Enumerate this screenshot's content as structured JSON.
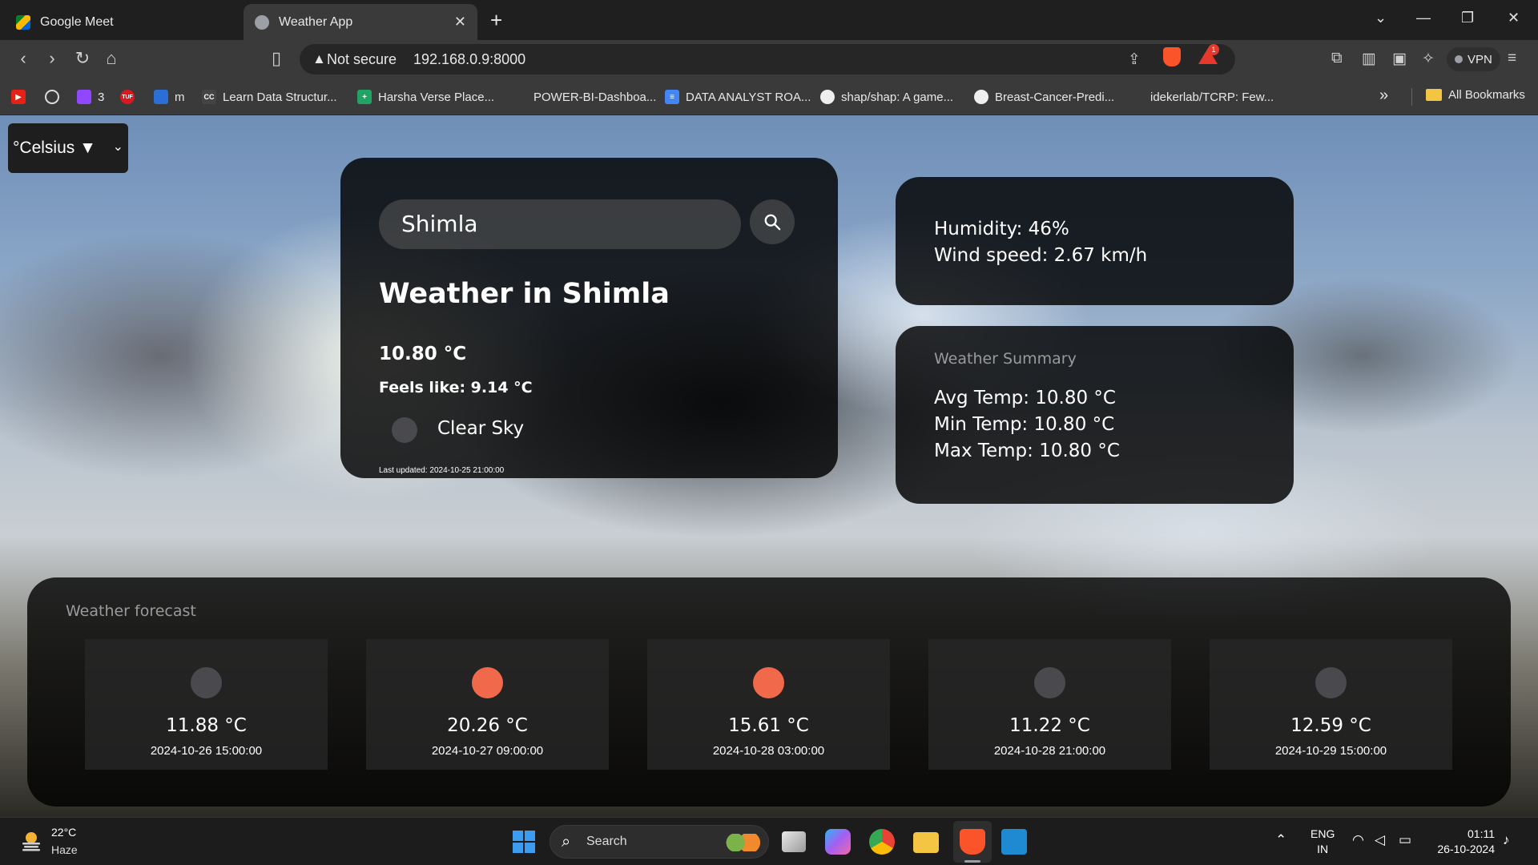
{
  "browser": {
    "tabs": [
      {
        "title": "Google Meet"
      },
      {
        "title": "Weather App"
      }
    ],
    "address": {
      "security_label": "Not secure",
      "url": "192.168.0.9:8000"
    },
    "vpn_label": "VPN",
    "rewards_badge": "1",
    "bookmarks": [
      {
        "label": "3"
      },
      {
        "label": "m"
      },
      {
        "label": "Learn Data Structur..."
      },
      {
        "label": "Harsha Verse Place..."
      },
      {
        "label": "POWER-BI-Dashboa..."
      },
      {
        "label": "DATA ANALYST ROA..."
      },
      {
        "label": "shap/shap: A game..."
      },
      {
        "label": "Breast-Cancer-Predi..."
      },
      {
        "label": "idekerlab/TCRP: Few..."
      }
    ],
    "all_bookmarks_label": "All Bookmarks"
  },
  "app": {
    "unit_selector": {
      "value": "°Celsius ▼"
    },
    "search": {
      "value": "Shimla"
    },
    "current": {
      "title": "Weather in Shimla",
      "temperature": "10.80 °C",
      "feels_like": "Feels like: 9.14 °C",
      "condition": "Clear Sky",
      "last_updated": "Last updated: 2024-10-25 21:00:00"
    },
    "details": {
      "humidity": "Humidity: 46%",
      "wind_speed": "Wind speed: 2.67 km/h"
    },
    "summary": {
      "title": "Weather Summary",
      "avg": "Avg Temp: 10.80 °C",
      "min": "Min Temp: 10.80 °C",
      "max": "Max Temp: 10.80 °C"
    },
    "forecast": {
      "title": "Weather forecast",
      "items": [
        {
          "temp": "11.88 °C",
          "date": "2024-10-26 15:00:00",
          "icon_color": "#4a4a4e"
        },
        {
          "temp": "20.26 °C",
          "date": "2024-10-27 09:00:00",
          "icon_color": "#f0694a"
        },
        {
          "temp": "15.61 °C",
          "date": "2024-10-28 03:00:00",
          "icon_color": "#f0694a"
        },
        {
          "temp": "11.22 °C",
          "date": "2024-10-28 21:00:00",
          "icon_color": "#4a4a4e"
        },
        {
          "temp": "12.59 °C",
          "date": "2024-10-29 15:00:00",
          "icon_color": "#4a4a4e"
        }
      ]
    }
  },
  "taskbar": {
    "weather_temp": "22°C",
    "weather_cond": "Haze",
    "search_label": "Search",
    "lang_top": "ENG",
    "lang_bottom": "IN",
    "time": "01:11",
    "date": "26-10-2024"
  },
  "colors": {
    "accent_orange": "#f0694a",
    "card_dark": "#000000",
    "brave_orange": "#fb542b"
  }
}
